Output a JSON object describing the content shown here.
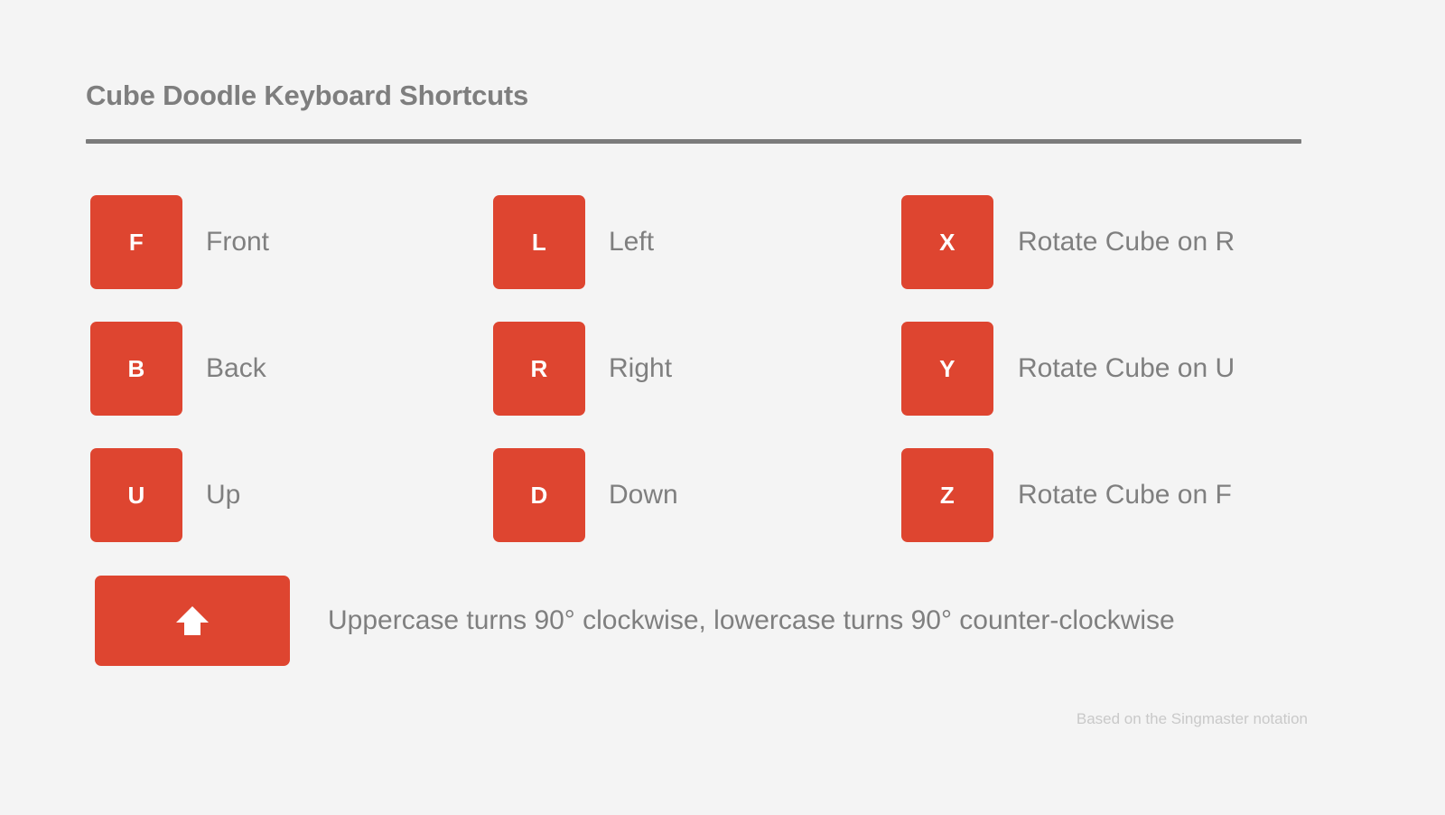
{
  "header": {
    "title": "Cube Doodle Keyboard Shortcuts"
  },
  "colors": {
    "background": "#f4f4f4",
    "key_fill": "#de4530",
    "key_text": "#ffffff",
    "label_text": "#7f7f7f",
    "title_text": "#7e7e7e",
    "rule": "#7b7b7b",
    "footer_text": "#c9c9c9"
  },
  "columns": [
    {
      "items": [
        {
          "key": "F",
          "label": "Front"
        },
        {
          "key": "B",
          "label": "Back"
        },
        {
          "key": "U",
          "label": "Up"
        }
      ]
    },
    {
      "items": [
        {
          "key": "L",
          "label": "Left"
        },
        {
          "key": "R",
          "label": "Right"
        },
        {
          "key": "D",
          "label": "Down"
        }
      ]
    },
    {
      "items": [
        {
          "key": "X",
          "label": "Rotate Cube on R"
        },
        {
          "key": "Y",
          "label": "Rotate Cube on U"
        },
        {
          "key": "Z",
          "label": "Rotate Cube on F"
        }
      ]
    }
  ],
  "shift_row": {
    "key_icon": "arrow-up-icon",
    "caption": "Uppercase turns 90° clockwise, lowercase turns 90° counter-clockwise"
  },
  "footer": {
    "note": "Based on the Singmaster notation"
  }
}
